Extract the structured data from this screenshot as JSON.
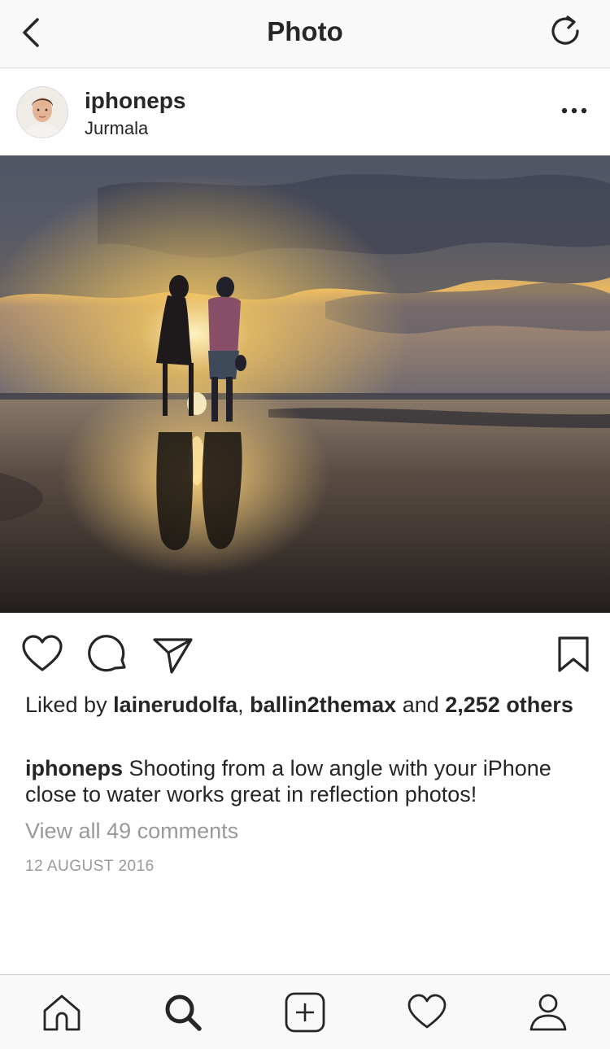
{
  "nav": {
    "title": "Photo",
    "back_icon": "chevron-left-icon",
    "refresh_icon": "refresh-icon"
  },
  "post": {
    "username": "iphoneps",
    "location": "Jurmala",
    "more_icon": "ellipsis-icon"
  },
  "likes": {
    "prefix": "Liked by ",
    "user1": "lainerudolfa",
    "sep": ", ",
    "user2": "ballin2themax",
    "and": " and ",
    "others": "2,252 others"
  },
  "caption": {
    "author": "iphoneps",
    "text": " Shooting from a low angle with your iPhone close to water works great in reflection photos!"
  },
  "comments_link": "View all 49 comments",
  "date": "12 AUGUST 2016",
  "tabbar": {
    "items": [
      "home-icon",
      "search-icon",
      "add-post-icon",
      "activity-heart-icon",
      "profile-icon"
    ],
    "active": "search-icon"
  },
  "colors": {
    "text": "#262626",
    "muted": "#999999",
    "bar": "#f9f9f9"
  }
}
